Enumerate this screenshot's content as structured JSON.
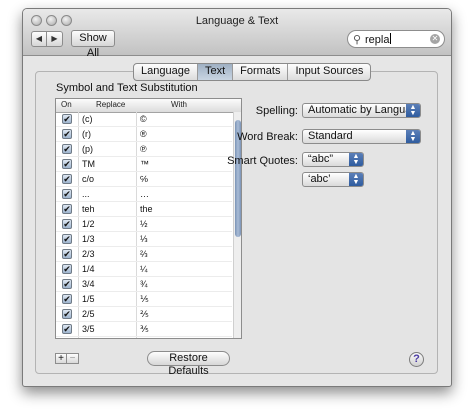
{
  "window": {
    "title": "Language & Text"
  },
  "toolbar": {
    "back_icon": "triangle-left",
    "forward_icon": "triangle-right",
    "show_all_label": "Show All",
    "search_value": "repla",
    "search_icon": "magnifier",
    "clear_icon": "circle-x"
  },
  "tabs": [
    {
      "label": "Language",
      "selected": false
    },
    {
      "label": "Text",
      "selected": true
    },
    {
      "label": "Formats",
      "selected": false
    },
    {
      "label": "Input Sources",
      "selected": false
    }
  ],
  "substitution": {
    "title": "Symbol and Text Substitution",
    "columns": [
      "On",
      "Replace",
      "With"
    ],
    "rows": [
      {
        "on": true,
        "replace": "(c)",
        "with": "©"
      },
      {
        "on": true,
        "replace": "(r)",
        "with": "®"
      },
      {
        "on": true,
        "replace": "(p)",
        "with": "℗"
      },
      {
        "on": true,
        "replace": "TM",
        "with": "™"
      },
      {
        "on": true,
        "replace": "c/o",
        "with": "℅"
      },
      {
        "on": true,
        "replace": "...",
        "with": "…"
      },
      {
        "on": true,
        "replace": "teh",
        "with": "the"
      },
      {
        "on": true,
        "replace": "1/2",
        "with": "½"
      },
      {
        "on": true,
        "replace": "1/3",
        "with": "⅓"
      },
      {
        "on": true,
        "replace": "2/3",
        "with": "⅔"
      },
      {
        "on": true,
        "replace": "1/4",
        "with": "¼"
      },
      {
        "on": true,
        "replace": "3/4",
        "with": "¾"
      },
      {
        "on": true,
        "replace": "1/5",
        "with": "⅕"
      },
      {
        "on": true,
        "replace": "2/5",
        "with": "⅖"
      },
      {
        "on": true,
        "replace": "3/5",
        "with": "⅗"
      }
    ],
    "add_label": "+",
    "remove_label": "−"
  },
  "settings": {
    "spelling_label": "Spelling:",
    "spelling_value": "Automatic by Language",
    "word_break_label": "Word Break:",
    "word_break_value": "Standard",
    "smart_quotes_label": "Smart Quotes:",
    "double_quotes_value": "“abc”",
    "single_quotes_value": "‘abc’"
  },
  "footer": {
    "restore_label": "Restore Defaults",
    "help_label": "?"
  },
  "colors": {
    "selected_tab": "#b3c3d6",
    "popup_arrows": "#3d66a8",
    "scroll_thumb": "#8aa2c4",
    "help_glyph": "#4a3aa3"
  }
}
